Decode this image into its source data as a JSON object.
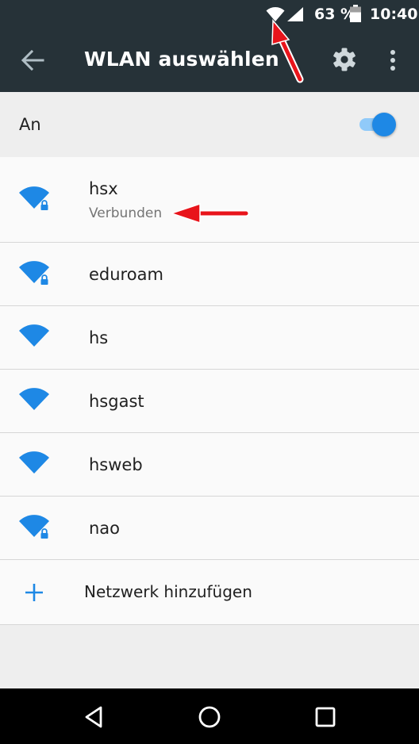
{
  "status_bar": {
    "battery_percent": "63 %",
    "time": "10:40",
    "icons": [
      "wifi-icon",
      "cell-signal-icon",
      "battery-icon"
    ]
  },
  "toolbar": {
    "title": "WLAN auswählen",
    "icons": [
      "back-arrow-icon",
      "settings-gear-icon",
      "more-vert-icon"
    ]
  },
  "master_switch": {
    "label": "An",
    "state": "on",
    "accent_color": "#1e88e5"
  },
  "networks": [
    {
      "ssid": "hsx",
      "status": "Verbunden",
      "secured": true
    },
    {
      "ssid": "eduroam",
      "secured": true
    },
    {
      "ssid": "hs",
      "secured": false
    },
    {
      "ssid": "hsgast",
      "secured": false
    },
    {
      "ssid": "hsweb",
      "secured": false
    },
    {
      "ssid": "nao",
      "secured": true
    }
  ],
  "add_network": {
    "label": "Netzwerk hinzufügen",
    "icon": "plus-icon"
  },
  "nav_bar": {
    "icons": [
      "nav-back-icon",
      "nav-home-icon",
      "nav-recents-icon"
    ]
  },
  "colors": {
    "toolbar": "#263238",
    "wifi": "#1e88e5",
    "annotation": "#e8141b"
  }
}
